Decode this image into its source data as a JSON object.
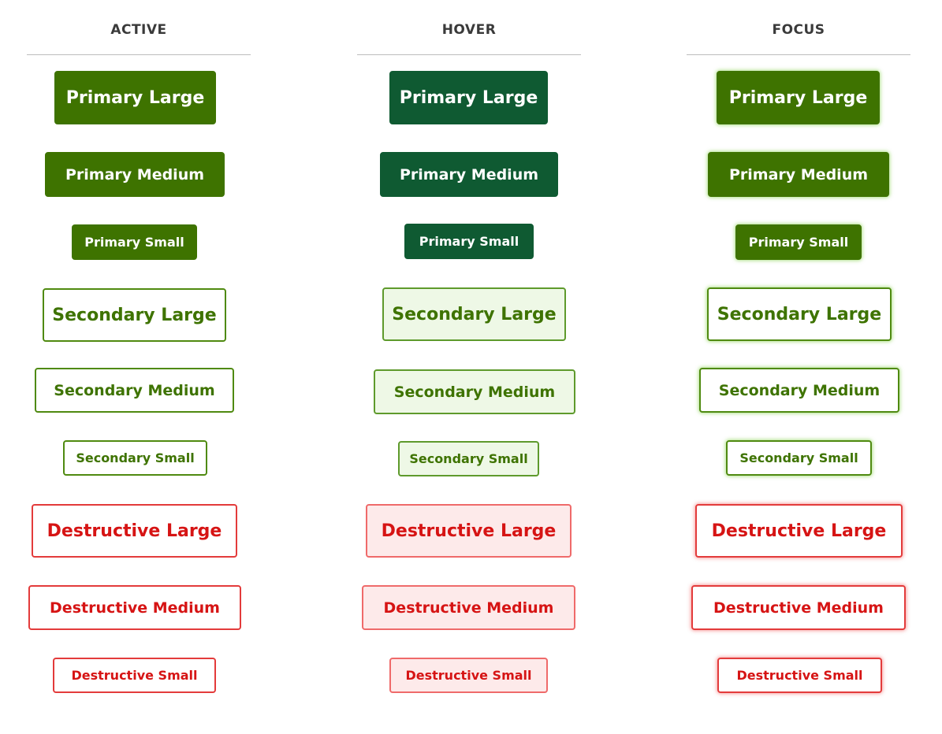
{
  "colors": {
    "primary": "#3e7300",
    "primary_hover": "#0f5a32",
    "secondary_text": "#3e7300",
    "secondary_hover_bg": "#eef8e6",
    "destructive": "#d61414",
    "destructive_hover_bg": "#fdeaea",
    "header_text": "#3a3a3a",
    "divider": "#bdbdbd"
  },
  "columns": {
    "active": {
      "title": "ACTIVE",
      "buttons": {
        "primary_large": "Primary Large",
        "primary_medium": "Primary Medium",
        "primary_small": "Primary Small",
        "secondary_large": "Secondary Large",
        "secondary_medium": "Secondary Medium",
        "secondary_small": "Secondary Small",
        "destructive_large": "Destructive Large",
        "destructive_medium": "Destructive Medium",
        "destructive_small": "Destructive Small"
      }
    },
    "hover": {
      "title": "HOVER",
      "buttons": {
        "primary_large": "Primary Large",
        "primary_medium": "Primary Medium",
        "primary_small": "Primary Small",
        "secondary_large": "Secondary Large",
        "secondary_medium": "Secondary Medium",
        "secondary_small": "Secondary Small",
        "destructive_large": "Destructive Large",
        "destructive_medium": "Destructive Medium",
        "destructive_small": "Destructive Small"
      }
    },
    "focus": {
      "title": "FOCUS",
      "buttons": {
        "primary_large": "Primary Large",
        "primary_medium": "Primary Medium",
        "primary_small": "Primary Small",
        "secondary_large": "Secondary Large",
        "secondary_medium": "Secondary Medium",
        "secondary_small": "Secondary Small",
        "destructive_large": "Destructive Large",
        "destructive_medium": "Destructive Medium",
        "destructive_small": "Destructive Small"
      }
    }
  }
}
